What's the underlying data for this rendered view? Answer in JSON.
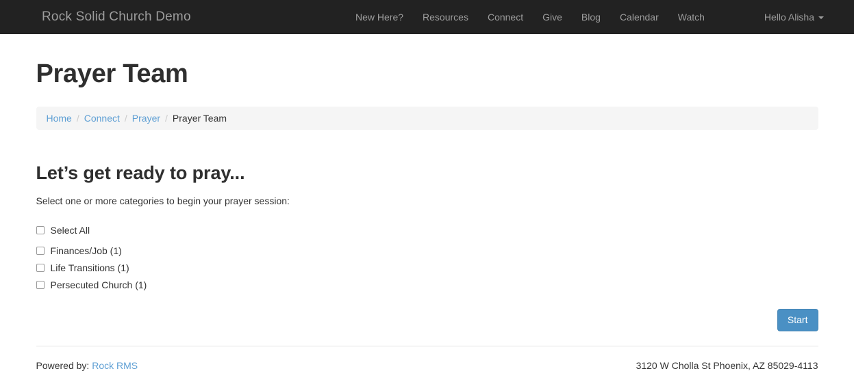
{
  "navbar": {
    "brand": "Rock Solid Church Demo",
    "links": [
      {
        "label": "New Here?"
      },
      {
        "label": "Resources"
      },
      {
        "label": "Connect"
      },
      {
        "label": "Give"
      },
      {
        "label": "Blog"
      },
      {
        "label": "Calendar"
      },
      {
        "label": "Watch"
      }
    ],
    "user_menu": {
      "label": "Hello Alisha",
      "caret_icon": "chevron-down-icon"
    },
    "background_color": "#222222",
    "link_color": "#9d9d9d"
  },
  "page": {
    "title": "Prayer Team"
  },
  "breadcrumb": {
    "separator": "/",
    "items": [
      {
        "label": "Home",
        "is_link": true
      },
      {
        "label": "Connect",
        "is_link": true
      },
      {
        "label": "Prayer",
        "is_link": true
      },
      {
        "label": "Prayer Team",
        "is_link": false
      }
    ],
    "link_color": "#5e9fd4",
    "background_color": "#f5f5f5"
  },
  "main": {
    "heading": "Let’s get ready to pray...",
    "subheading": "Select one or more categories to begin your prayer session:",
    "select_all": {
      "label": "Select All",
      "checked": false
    },
    "categories": [
      {
        "label": "Finances/Job (1)",
        "checked": false
      },
      {
        "label": "Life Transitions (1)",
        "checked": false
      },
      {
        "label": "Persecuted Church (1)",
        "checked": false
      }
    ],
    "start_button": {
      "label": "Start",
      "color": "#4a90c4"
    }
  },
  "footer": {
    "powered_by_label": "Powered by:",
    "powered_by_link": "Rock RMS",
    "address": "3120 W Cholla St Phoenix, AZ 85029-4113"
  }
}
